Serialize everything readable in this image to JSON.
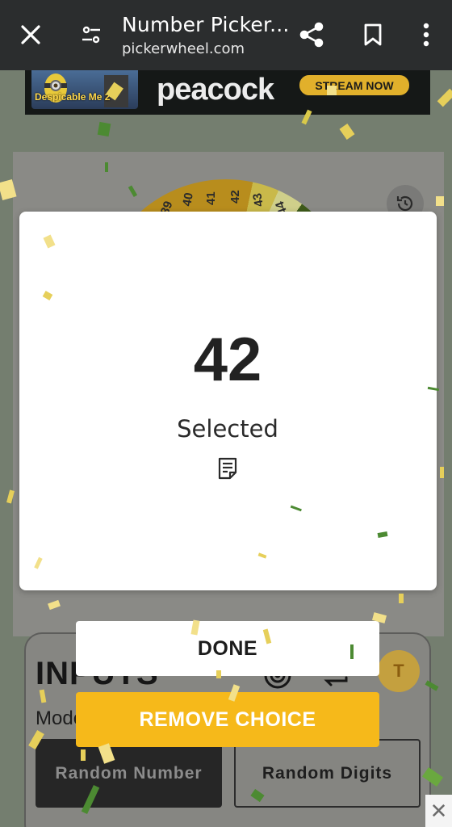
{
  "browser": {
    "title": "Number Picker...",
    "url": "pickerwheel.com",
    "icons": [
      "close-icon",
      "site-settings-icon",
      "share-icon",
      "bookmark-icon",
      "more-options-icon"
    ]
  },
  "ad": {
    "thumb_caption": "Despicable Me 2",
    "brand": "peacock",
    "cta": "STREAM NOW"
  },
  "wheel": {
    "visible_numbers": [
      "39",
      "40",
      "41",
      "42",
      "43",
      "44"
    ],
    "colors": [
      "#b88d1d",
      "#c9b94a",
      "#cfcf8a",
      "#3e5a1a"
    ]
  },
  "result_modal": {
    "value": "42",
    "label": "Selected",
    "notes_icon": "notes-icon"
  },
  "actions": {
    "done_label": "DONE",
    "remove_label": "REMOVE CHOICE"
  },
  "inputs_panel": {
    "title": "INPUTS",
    "mode_label": "Mode",
    "avatar_initial": "T",
    "mode_buttons": [
      "Random Number",
      "Random Digits"
    ]
  },
  "colors": {
    "accent": "#f6b91a",
    "topbar": "#2b2d2e",
    "confetti": [
      "#e6cf5a",
      "#f2e08a",
      "#4c8a32",
      "#d9c94a",
      "#6aa83f"
    ]
  }
}
